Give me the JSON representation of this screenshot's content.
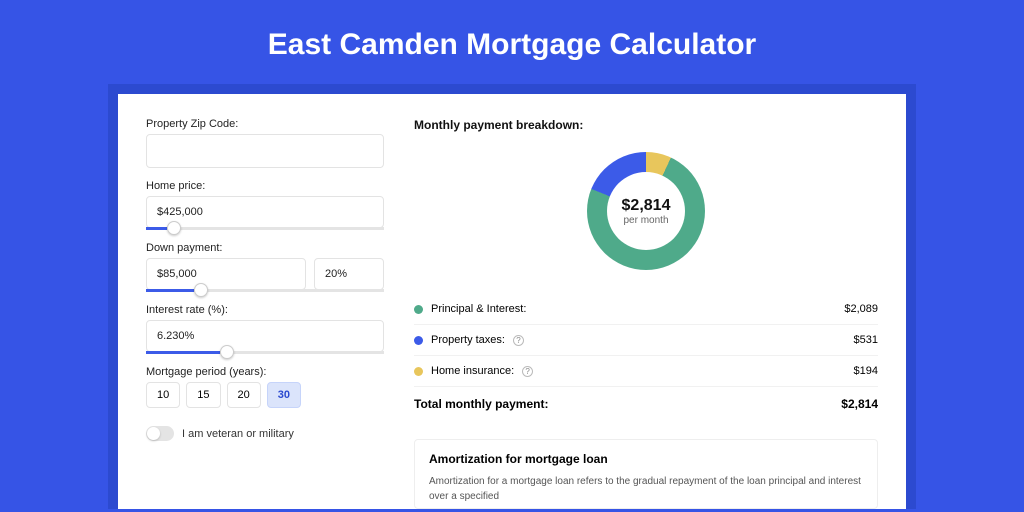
{
  "title": "East Camden Mortgage Calculator",
  "form": {
    "zip_label": "Property Zip Code:",
    "zip_value": "",
    "home_price_label": "Home price:",
    "home_price_value": "$425,000",
    "down_label": "Down payment:",
    "down_value": "$85,000",
    "down_pct": "20%",
    "rate_label": "Interest rate (%):",
    "rate_value": "6.230%",
    "period_label": "Mortgage period (years):",
    "periods": [
      "10",
      "15",
      "20",
      "30"
    ],
    "period_active": "30",
    "veteran_label": "I am veteran or military"
  },
  "breakdown": {
    "heading": "Monthly payment breakdown:",
    "amount": "$2,814",
    "per": "per month",
    "items": [
      {
        "color": "green",
        "label": "Principal & Interest:",
        "help": false,
        "value": "$2,089"
      },
      {
        "color": "blue",
        "label": "Property taxes:",
        "help": true,
        "value": "$531"
      },
      {
        "color": "yellow",
        "label": "Home insurance:",
        "help": true,
        "value": "$194"
      }
    ],
    "total_label": "Total monthly payment:",
    "total_value": "$2,814"
  },
  "amortization": {
    "title": "Amortization for mortgage loan",
    "body": "Amortization for a mortgage loan refers to the gradual repayment of the loan principal and interest over a specified"
  },
  "chart_data": {
    "type": "pie",
    "title": "Monthly payment breakdown",
    "series": [
      {
        "name": "Principal & Interest",
        "value": 2089,
        "color": "#4faa8a"
      },
      {
        "name": "Property taxes",
        "value": 531,
        "color": "#3c5be8"
      },
      {
        "name": "Home insurance",
        "value": 194,
        "color": "#e8c65c"
      }
    ],
    "total": 2814,
    "center_label": "$2,814 per month"
  }
}
